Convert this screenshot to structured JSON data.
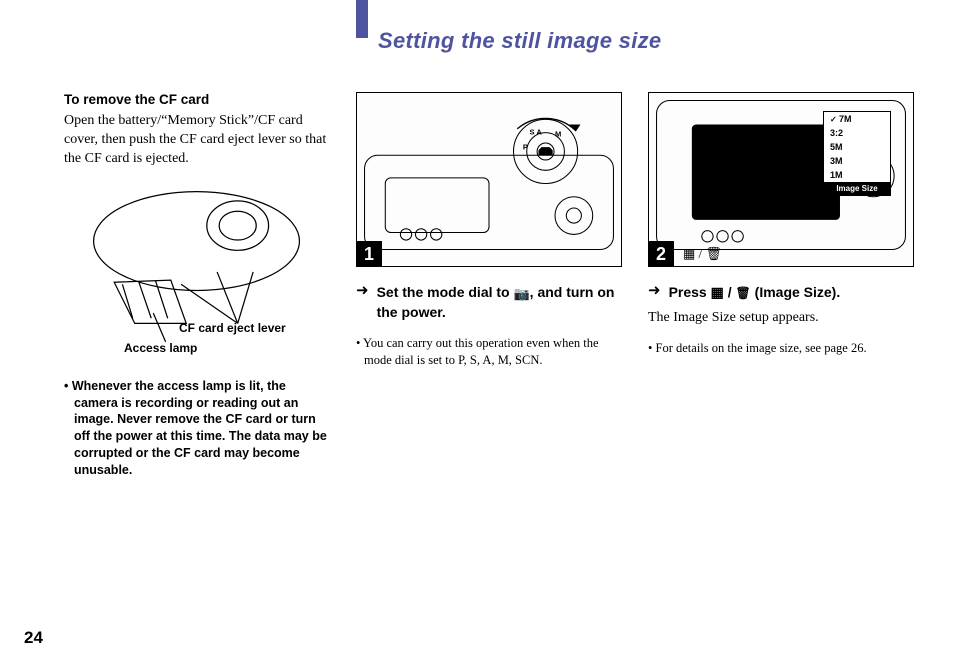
{
  "headline": "Setting the still image size",
  "left": {
    "h4": "To remove the CF card",
    "body": "Open the battery/“Memory Stick”/CF card cover, then push the CF card eject lever so that the CF card is ejected.",
    "callout_eject": "CF card eject lever",
    "callout_lamp": "Access lamp",
    "warning": "Whenever the access lamp is lit, the camera is recording or reading out an image. Never remove the CF card or turn off the power at this time. The data may be corrupted or the CF card may become unusable."
  },
  "step1": {
    "num": "1",
    "text_a": "Set the mode dial to ",
    "text_b": ", and turn on the power.",
    "note": "You can carry out this operation even when the mode dial is set to P, S, A, M, SCN."
  },
  "step2": {
    "num": "2",
    "text_a": "Press ",
    "text_b": " (Image Size).",
    "followup": "The Image Size setup appears.",
    "note": "For details on the image size, see page 26.",
    "menu": {
      "items": [
        "7M",
        "3:2",
        "5M",
        "3M",
        "1M"
      ],
      "label": "Image Size"
    }
  },
  "page_number": "24"
}
